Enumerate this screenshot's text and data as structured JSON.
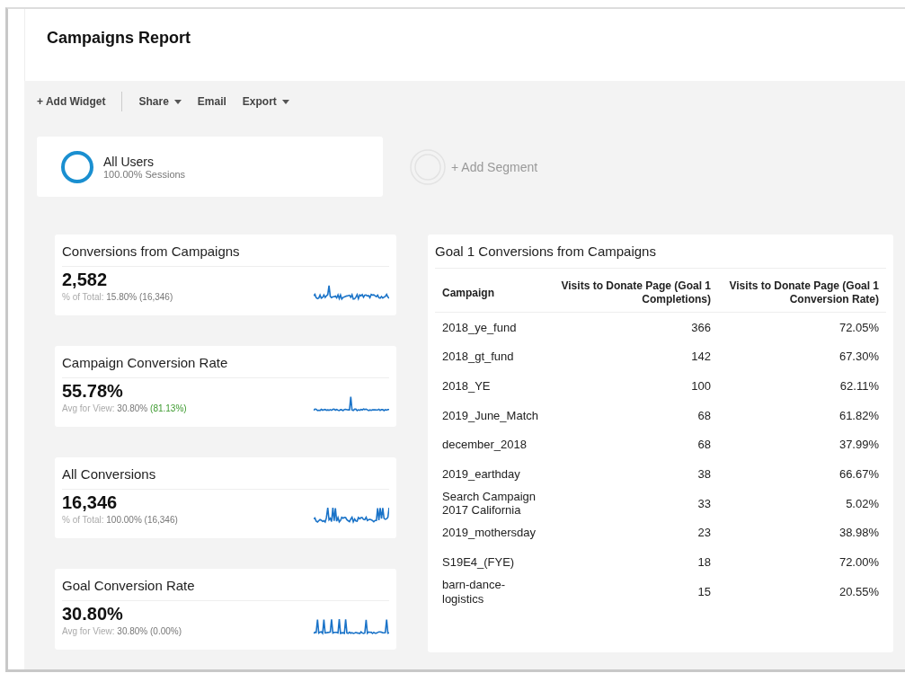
{
  "report": {
    "title": "Campaigns Report"
  },
  "toolbar": [
    {
      "label": "+ Add Widget",
      "kind": "plain"
    },
    {
      "label": "Share",
      "kind": "menu"
    },
    {
      "label": "Email",
      "kind": "plain"
    },
    {
      "label": "Export",
      "kind": "menu"
    }
  ],
  "segments": {
    "active": {
      "name": "All Users",
      "detail": "100.00% Sessions"
    },
    "add": {
      "label": "+ Add Segment"
    }
  },
  "metrics": [
    {
      "title": "Conversions from Campaigns",
      "value": "2,582",
      "sub_label": "% of Total:",
      "sub_value": "15.80% (16,346)"
    },
    {
      "title": "Campaign Conversion Rate",
      "value": "55.78%",
      "sub_label": "Avg for View:",
      "sub_value": "30.80%",
      "delta": "(81.13%)",
      "delta_up": true
    },
    {
      "title": "All Conversions",
      "value": "16,346",
      "sub_label": "% of Total:",
      "sub_value": "100.00% (16,346)"
    },
    {
      "title": "Goal Conversion Rate",
      "value": "30.80%",
      "sub_label": "Avg for View:",
      "sub_value": "30.80% (0.00%)"
    }
  ],
  "table": {
    "title": "Goal 1 Conversions from Campaigns",
    "columns": [
      "Campaign",
      "Visits to Donate Page (Goal 1 Completions)",
      "Visits to Donate Page (Goal 1 Conversion Rate)"
    ],
    "rows": [
      [
        "2018_ye_fund",
        "366",
        "72.05%"
      ],
      [
        "2018_gt_fund",
        "142",
        "67.30%"
      ],
      [
        "2018_YE",
        "100",
        "62.11%"
      ],
      [
        "2019_June_Match",
        "68",
        "61.82%"
      ],
      [
        "december_2018",
        "68",
        "37.99%"
      ],
      [
        "2019_earthday",
        "38",
        "66.67%"
      ],
      [
        "Search Campaign 2017 California",
        "33",
        "5.02%"
      ],
      [
        "2019_mothersday",
        "23",
        "38.98%"
      ],
      [
        "S19E4_(FYE)",
        "18",
        "72.00%"
      ],
      [
        "barn-dance-logistics",
        "15",
        "20.55%"
      ]
    ]
  }
}
